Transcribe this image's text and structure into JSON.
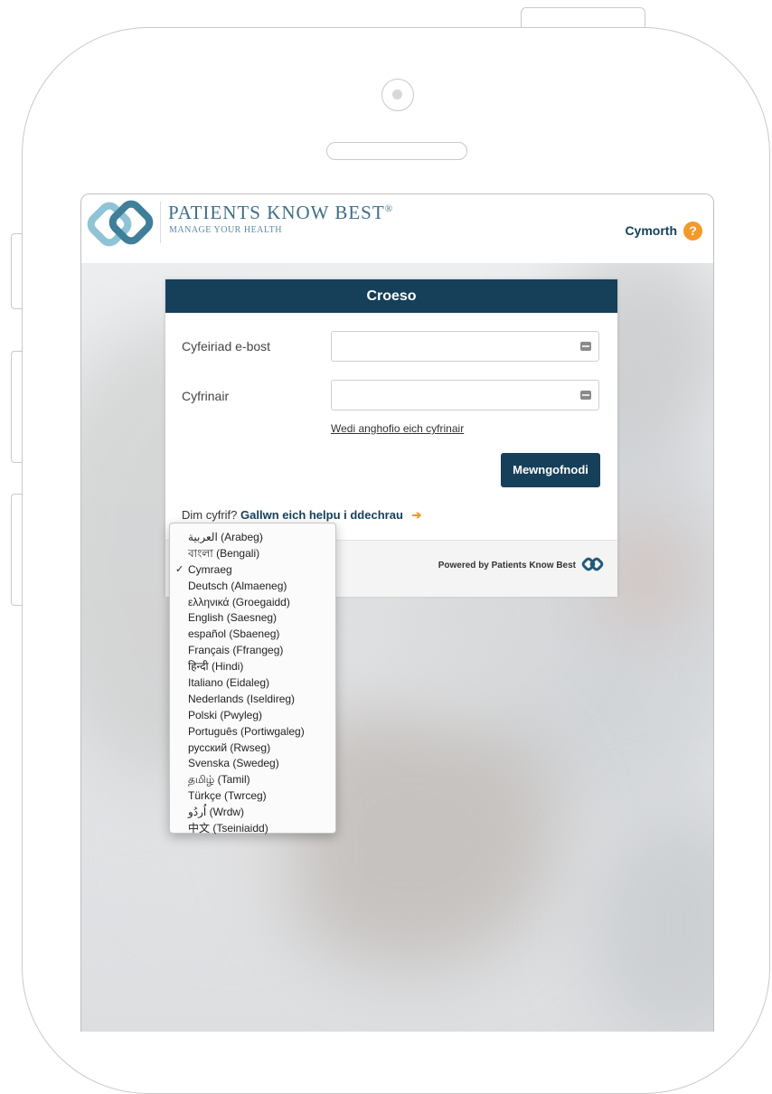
{
  "brand": {
    "name": "PATIENTS KNOW BEST",
    "registered_mark": "®",
    "tagline": "MANAGE YOUR HEALTH"
  },
  "header": {
    "help_label": "Cymorth",
    "help_icon": "question-mark-icon",
    "help_glyph": "?",
    "help_color": "#f39a2b"
  },
  "login_panel": {
    "title": "Croeso",
    "email_label": "Cyfeiriad e-bost",
    "email_value": "",
    "password_label": "Cyfrinair",
    "password_value": "",
    "forgot_password": "Wedi anghofio eich cyfrinair",
    "login_button": "Mewngofnodi",
    "no_account": "Dim cyfrif?",
    "signup_link": "Gallwn eich helpu i ddechrau",
    "arrow_glyph": "➔",
    "powered_by": "Powered by Patients Know Best"
  },
  "language_menu": {
    "selected": "Cymraeg",
    "check_glyph": "✓",
    "items": [
      "العربية (Arabeg)",
      "বাংলা (Bengali)",
      "Cymraeg",
      "Deutsch (Almaeneg)",
      "ελληνικά (Groegaidd)",
      "English (Saesneg)",
      "español (Sbaeneg)",
      "Français (Ffrangeg)",
      "हिन्दी (Hindi)",
      "Italiano (Eidaleg)",
      "Nederlands (Iseldireg)",
      "Polski (Pwyleg)",
      "Português (Portiwgaleg)",
      "русский (Rwseg)",
      "Svenska (Swedeg)",
      "தமிழ் (Tamil)",
      "Türkçe (Twrceg)",
      "اُردُو (Wrdw)",
      "中文 (Tseiniaidd)"
    ]
  },
  "colors": {
    "primary": "#163f59",
    "accent": "#f39a2b",
    "logo_light": "#8fc3d6",
    "logo_dark": "#3f7f9a"
  }
}
